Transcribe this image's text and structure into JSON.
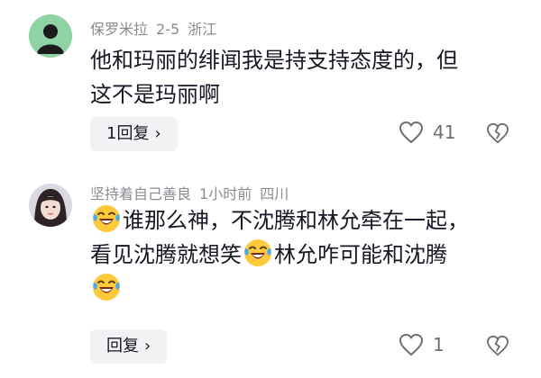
{
  "comments": [
    {
      "username": "保罗米拉",
      "date": "2-5",
      "location": "浙江",
      "text_line1": "他和玛丽的绯闻我是持支持态度的，但",
      "text_line2": "这不是玛丽啊",
      "reply_label": "1回复",
      "like_count": "41",
      "avatar": "default-avatar-icon",
      "avatar_color": "#8fd3a4"
    },
    {
      "username": "坚持着自己善良",
      "date": "1小时前",
      "location": "四川",
      "text_part1": "谁那么神，不沈腾和林允牵在一起，",
      "text_part2": "看见沈腾就想笑",
      "text_part3": "林允咋可能和沈腾",
      "reply_label": "回复",
      "like_count": "1",
      "avatar": "user-photo-avatar",
      "emoji": "laugh-cry-emoji"
    }
  ],
  "icons": {
    "reply_chevron": "›",
    "like": "heart-outline-icon",
    "dislike": "broken-heart-icon"
  },
  "colors": {
    "meta_text": "#8a8b91",
    "body_text": "#161823",
    "reply_bg": "#f2f2f4"
  }
}
